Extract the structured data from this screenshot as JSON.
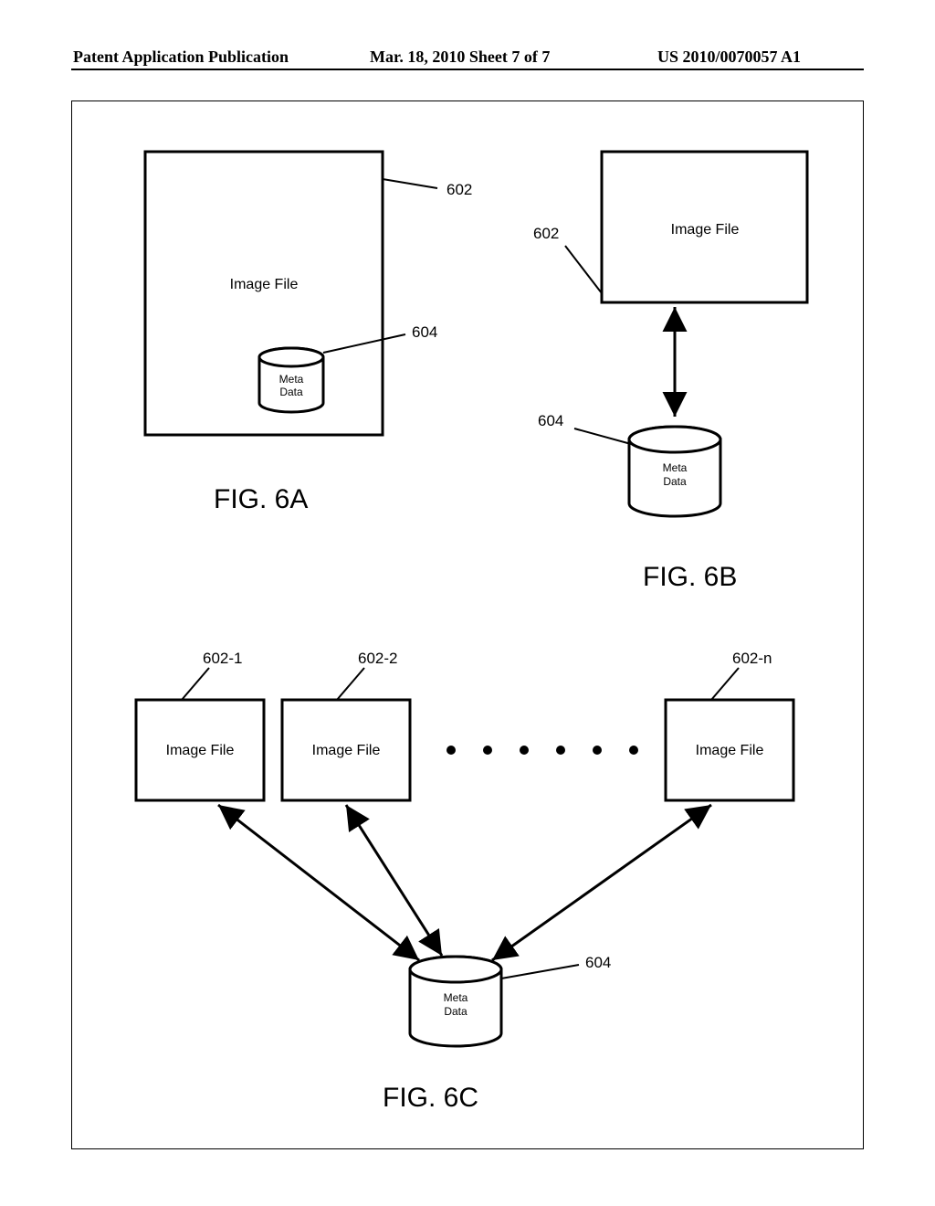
{
  "header": {
    "left": "Patent Application Publication",
    "middle": "Mar. 18, 2010  Sheet 7 of 7",
    "right": "US 2010/0070057 A1"
  },
  "labels": {
    "imageFile": "Image File",
    "metaLine1": "Meta",
    "metaLine2": "Data"
  },
  "refnums": {
    "a602": "602",
    "a604": "604",
    "b602": "602",
    "b604": "604",
    "c602_1": "602-1",
    "c602_2": "602-2",
    "c602_n": "602-n",
    "c604": "604"
  },
  "figs": {
    "a": "FIG. 6A",
    "b": "FIG. 6B",
    "c": "FIG. 6C"
  }
}
